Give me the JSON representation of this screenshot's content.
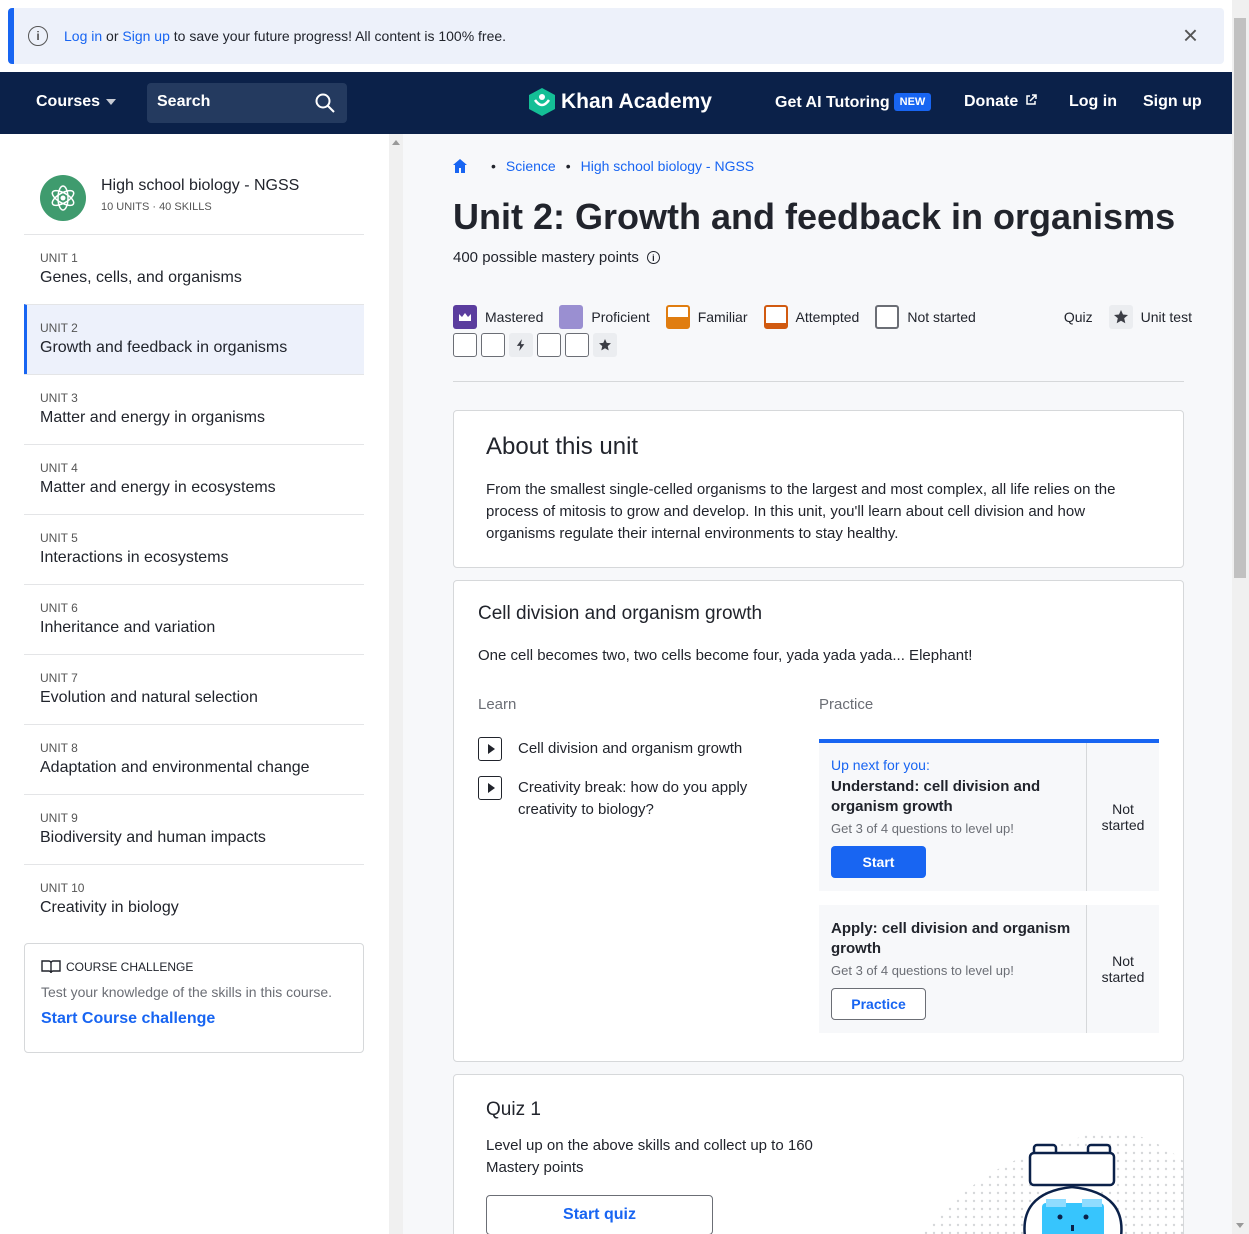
{
  "banner": {
    "login": "Log in",
    "or": " or ",
    "signup": "Sign up",
    "rest": " to save your future progress! All content is 100% free."
  },
  "nav": {
    "courses": "Courses",
    "search": "Search",
    "logo": "Khan Academy",
    "ai": "Get AI Tutoring",
    "new_badge": "NEW",
    "donate": "Donate",
    "login": "Log in",
    "signup": "Sign up"
  },
  "sidebar": {
    "course_title": "High school biology - NGSS",
    "course_sub": "10 UNITS · 40 SKILLS",
    "units": [
      {
        "num": "UNIT 1",
        "label": "Genes, cells, and organisms"
      },
      {
        "num": "UNIT 2",
        "label": "Growth and feedback in organisms"
      },
      {
        "num": "UNIT 3",
        "label": "Matter and energy in organisms"
      },
      {
        "num": "UNIT 4",
        "label": "Matter and energy in ecosystems"
      },
      {
        "num": "UNIT 5",
        "label": "Interactions in ecosystems"
      },
      {
        "num": "UNIT 6",
        "label": "Inheritance and variation"
      },
      {
        "num": "UNIT 7",
        "label": "Evolution and natural selection"
      },
      {
        "num": "UNIT 8",
        "label": "Adaptation and environmental change"
      },
      {
        "num": "UNIT 9",
        "label": "Biodiversity and human impacts"
      },
      {
        "num": "UNIT 10",
        "label": "Creativity in biology"
      }
    ],
    "challenge": {
      "heading": "COURSE CHALLENGE",
      "desc": "Test your knowledge of the skills in this course.",
      "link": "Start Course challenge"
    }
  },
  "main": {
    "breadcrumbs": [
      "Science",
      "High school biology - NGSS"
    ],
    "title": "Unit 2: Growth and feedback in organisms",
    "mastery_points": "400 possible mastery points",
    "legend": [
      "Mastered",
      "Proficient",
      "Familiar",
      "Attempted",
      "Not started",
      "Quiz",
      "Unit test"
    ],
    "about": {
      "heading": "About this unit",
      "text": "From the smallest single-celled organisms to the largest and most complex, all life relies on the process of mitosis to grow and develop. In this unit, you'll learn about cell division and how organisms regulate their internal environments to stay healthy."
    },
    "lesson": {
      "heading": "Cell division and organism growth",
      "desc": "One cell becomes two, two cells become four, yada yada yada... Elephant!",
      "learn_label": "Learn",
      "practice_label": "Practice",
      "videos": [
        "Cell division and organism growth",
        "Creativity break: how do you apply creativity to biology?"
      ],
      "practice": [
        {
          "upnext": "Up next for you:",
          "name": "Understand: cell division and organism growth",
          "sub": "Get 3 of 4 questions to level up!",
          "button": "Start",
          "status": "Not started"
        },
        {
          "name": "Apply: cell division and organism growth",
          "sub": "Get 3 of 4 questions to level up!",
          "button": "Practice",
          "status": "Not started"
        }
      ]
    },
    "quiz": {
      "heading": "Quiz 1",
      "text": "Level up on the above skills and collect up to 160 Mastery points",
      "button": "Start quiz"
    }
  },
  "colors": {
    "brand_blue": "#1865f2",
    "nav_bg": "#0b2149",
    "mastered": "#5b3d9e",
    "proficient": "#9a8fd1",
    "familiar": "#e07d10",
    "attempted": "#d15a10"
  }
}
